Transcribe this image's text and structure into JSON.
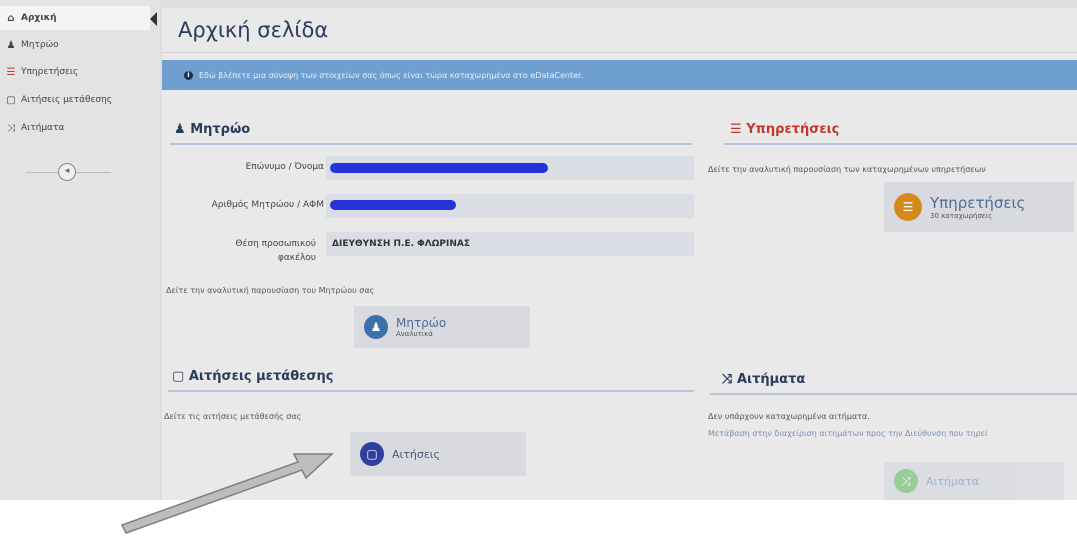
{
  "sidebar": {
    "items": [
      {
        "label": "Αρχική",
        "icon": "home-icon",
        "glyph": "⌂"
      },
      {
        "label": "Μητρώο",
        "icon": "user-icon",
        "glyph": "♟"
      },
      {
        "label": "Υπηρετήσεις",
        "icon": "list-icon",
        "glyph": "☰"
      },
      {
        "label": "Αιτήσεις μετάθεσης",
        "icon": "file-icon",
        "glyph": "▢"
      },
      {
        "label": "Αιτήματα",
        "icon": "shuffle-icon",
        "glyph": "⤨"
      }
    ],
    "toggle_glyph": "◂"
  },
  "header": {
    "title": "Αρχική σελίδα"
  },
  "info": {
    "icon": "info-icon",
    "glyph": "i",
    "text": "Εδώ βλέπετε μια σύνοψη των στοιχείων σας όπως είναι τώρα καταχωρημένα στο eDataCenter."
  },
  "registry": {
    "title": "Μητρώο",
    "title_glyph": "♟",
    "fields": [
      {
        "label": "Επώνυμο / Όνομα",
        "value": ""
      },
      {
        "label": "Αριθμός Μητρώου / ΑΦΜ",
        "value": ""
      },
      {
        "label": "Θέση προσωπικού φακέλου",
        "value": "ΔΙΕΥΘΥΝΣΗ Π.Ε. ΦΛΩΡΙΝΑΣ"
      }
    ],
    "desc": "Δείτε την αναλυτική παρουσίαση του Μητρώου σας",
    "tile": {
      "label": "Μητρώο",
      "sub": "Αναλυτικά",
      "glyph": "♟",
      "color": "#3d6fa8"
    }
  },
  "services": {
    "title": "Υπηρετήσεις",
    "title_glyph": "☰",
    "title_color": "#c0392b",
    "desc": "Δείτε την αναλυτική παρουσίαση των καταχωρημένων υπηρετήσεων",
    "tile": {
      "label": "Υπηρετήσεις",
      "sub": "30 καταχωρήσεις",
      "glyph": "☰",
      "color": "#d68a1c"
    }
  },
  "transfers": {
    "title": "Αιτήσεις μετάθεσης",
    "title_glyph": "▢",
    "desc": "Δείτε τις αιτήσεις μετάθεσής σας",
    "tile": {
      "label": "Αιτήσεις",
      "glyph": "▢",
      "color": "#2f3f9e"
    }
  },
  "requests": {
    "title": "Αιτήματα",
    "title_glyph": "⤨",
    "desc1": "Δεν υπάρχουν καταχωρημένα αιτήματα.",
    "desc2": "Μετάβαση στην διαχείριση αιτημάτων προς την Διεύθυνση που τηρεί",
    "tile": {
      "label": "Αιτήματα",
      "glyph": "⤨",
      "color": "#7cc47c"
    }
  }
}
